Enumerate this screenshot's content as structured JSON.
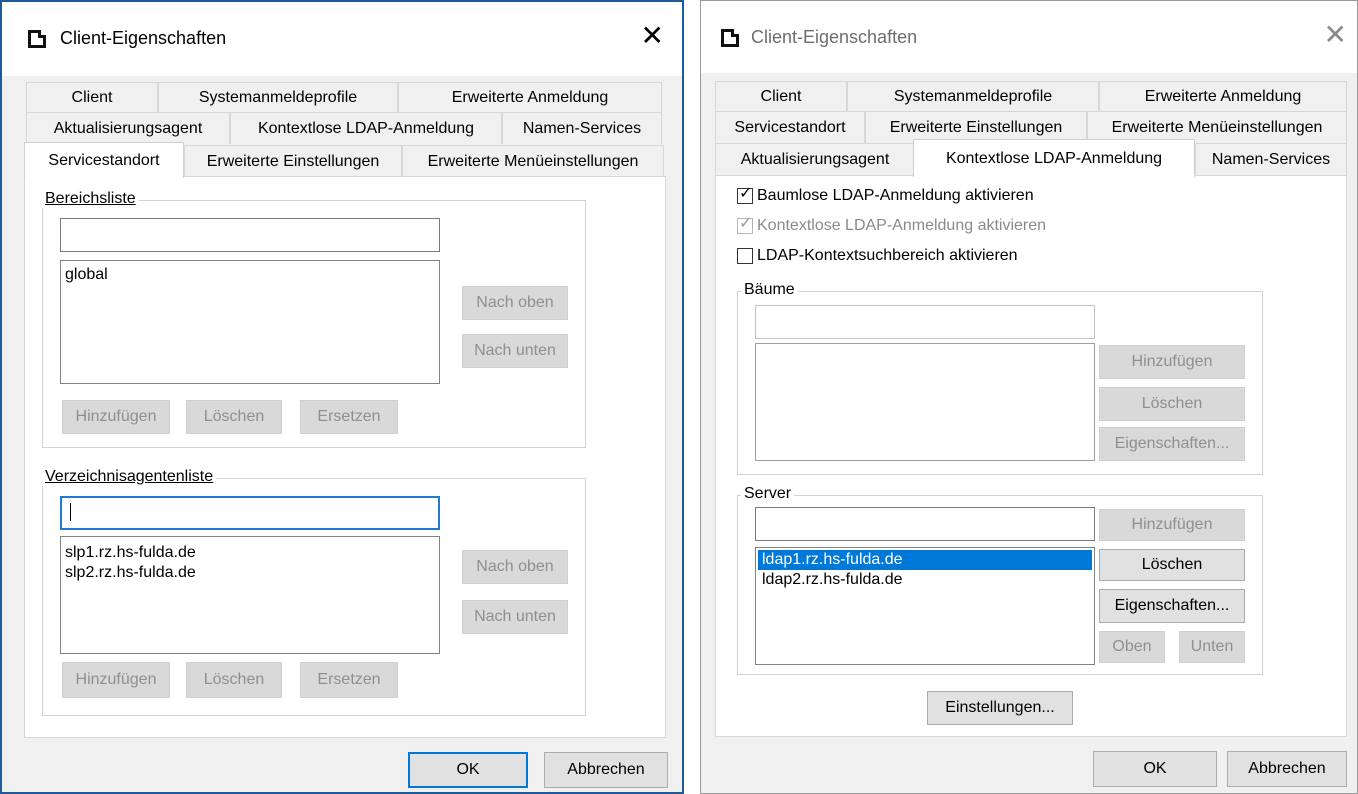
{
  "window_left": {
    "title": "Client-Eigenschaften",
    "tabs_row1": [
      "Client",
      "Systemanmeldeprofile",
      "Erweiterte Anmeldung"
    ],
    "tabs_row2": [
      "Aktualisierungsagent",
      "Kontextlose LDAP-Anmeldung",
      "Namen-Services"
    ],
    "tabs_row3": [
      "Servicestandort",
      "Erweiterte Einstellungen",
      "Erweiterte Menüeinstellungen"
    ],
    "selected_tab": "Servicestandort",
    "bereich": {
      "label": "Bereichsliste",
      "input_value": "",
      "items": [
        "global"
      ],
      "up": "Nach oben",
      "down": "Nach unten",
      "add": "Hinzufügen",
      "delete": "Löschen",
      "replace": "Ersetzen"
    },
    "verzeichnis": {
      "label": "Verzeichnisagentenliste",
      "input_value": "",
      "items": [
        "slp1.rz.hs-fulda.de",
        "slp2.rz.hs-fulda.de"
      ],
      "up": "Nach oben",
      "down": "Nach unten",
      "add": "Hinzufügen",
      "delete": "Löschen",
      "replace": "Ersetzen"
    },
    "ok": "OK",
    "cancel": "Abbrechen"
  },
  "window_right": {
    "title": "Client-Eigenschaften",
    "tabs_row1": [
      "Client",
      "Systemanmeldeprofile",
      "Erweiterte Anmeldung"
    ],
    "tabs_row2": [
      "Servicestandort",
      "Erweiterte Einstellungen",
      "Erweiterte Menüeinstellungen"
    ],
    "tabs_row3": [
      "Aktualisierungsagent",
      "Kontextlose LDAP-Anmeldung",
      "Namen-Services"
    ],
    "selected_tab": "Kontextlose LDAP-Anmeldung",
    "checkboxes": [
      {
        "label": "Baumlose LDAP-Anmeldung aktivieren",
        "checked": true,
        "enabled": true
      },
      {
        "label": "Kontextlose LDAP-Anmeldung aktivieren",
        "checked": true,
        "enabled": false
      },
      {
        "label": "LDAP-Kontextsuchbereich aktivieren",
        "checked": false,
        "enabled": true
      }
    ],
    "baeume": {
      "label": "Bäume",
      "input_value": "",
      "add": "Hinzufügen",
      "delete": "Löschen",
      "props": "Eigenschaften..."
    },
    "server": {
      "label": "Server",
      "input_value": "",
      "items": [
        "ldap1.rz.hs-fulda.de",
        "ldap2.rz.hs-fulda.de"
      ],
      "selected_index": 0,
      "add": "Hinzufügen",
      "delete": "Löschen",
      "props": "Eigenschaften...",
      "up": "Oben",
      "down": "Unten"
    },
    "settings": "Einstellungen...",
    "ok": "OK",
    "cancel": "Abbrechen"
  }
}
